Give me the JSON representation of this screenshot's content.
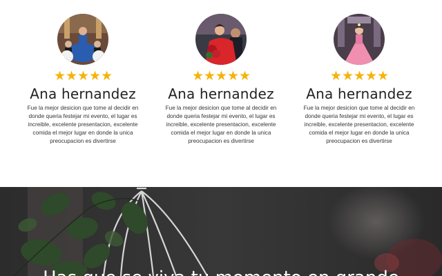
{
  "testimonials": [
    {
      "name": "Ana hernandez",
      "stars": [
        "★",
        "★",
        "★",
        "★",
        "★"
      ],
      "rating": 5,
      "text": "Fue la mejor desicion que tome al decidir en donde queria festejar mi evento, el lugar es increible, excelente presentacion, excelente comida el mejor lugar en donde la unica preocupacion es divertirse",
      "dress_color": "#2a5db0"
    },
    {
      "name": "Ana hernandez",
      "stars": [
        "★",
        "★",
        "★",
        "★",
        "★"
      ],
      "rating": 5,
      "text": "Fue la mejor desicion que tome al decidir en donde queria festejar mi evento, el lugar es increible, excelente presentacion, excelente comida el mejor lugar en donde la unica preocupacion es divertirse",
      "dress_color": "#d9262a"
    },
    {
      "name": "Ana hernandez",
      "stars": [
        "★",
        "★",
        "★",
        "★",
        "★"
      ],
      "rating": 5,
      "text": "Fue la mejor desicion que tome al decidir en donde queria festejar mi evento, el lugar es increible, excelente presentacion, excelente comida el mejor lugar en donde la unica preocupacion es divertirse",
      "dress_color": "#f08fb0"
    }
  ],
  "hero": {
    "heading": "Has que se viva tu momento en grande"
  },
  "colors": {
    "star": "#f5b30a",
    "hero_bg": "#2b2b2b"
  }
}
